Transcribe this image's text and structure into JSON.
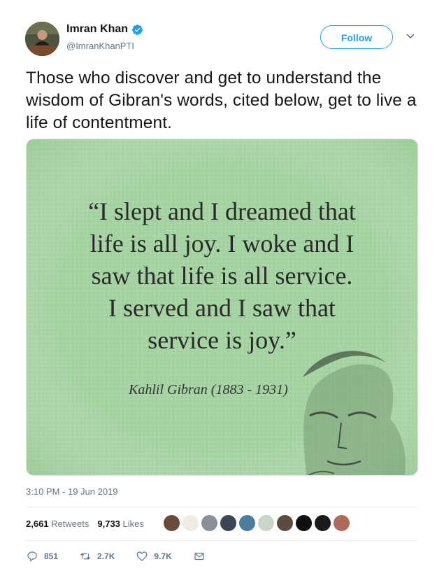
{
  "author": {
    "name": "Imran Khan",
    "handle": "@ImranKhanPTI",
    "verified_icon": "verified-badge-icon"
  },
  "header": {
    "follow_label": "Follow",
    "menu_icon": "chevron-down-icon"
  },
  "tweet": {
    "text": "Those who discover and get to understand the wisdom of Gibran's words, cited below, get to live a life of contentment.",
    "timestamp": "3:10 PM - 19 Jun 2019"
  },
  "media": {
    "quote_lines": [
      "“I slept and I dreamed that",
      "life is all joy. I woke and I",
      "saw that life is all service.",
      "I served and I saw that",
      "service is joy.”"
    ],
    "attribution": "Kahlil Gibran (1883 - 1931)",
    "background_color": "#a6d3a3"
  },
  "stats": {
    "retweets_count": "2,661",
    "retweets_label": "Retweets",
    "likes_count": "9,733",
    "likes_label": "Likes"
  },
  "actions": {
    "reply_count": "851",
    "retweet_count": "2.7K",
    "like_count": "9.7K"
  },
  "colors": {
    "accent": "#1da1f2",
    "secondary_text": "#657786"
  }
}
